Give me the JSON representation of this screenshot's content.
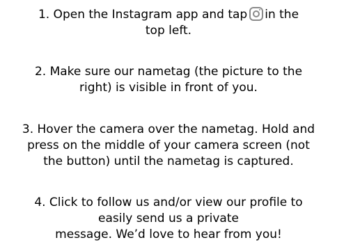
{
  "instructions": {
    "step1": {
      "line1_before_icon": "1.  Open the Instagram app and tap",
      "icon": "instagram-camera-icon",
      "line1_after_icon": "in the",
      "line2": "top left."
    },
    "step2": {
      "line1": "2. Make sure our nametag (the picture to the",
      "line2": "right) is visible in front of you."
    },
    "step3": {
      "line1": "3. Hover the camera over the nametag. Hold and",
      "line2": "press on the middle of your camera screen (not",
      "line3": "the button) until the nametag is captured."
    },
    "step4": {
      "line1": "4. Click to follow us and/or view our profile to",
      "line2": "easily send us a private",
      "line3": "message.  We’d love to hear from you!"
    }
  }
}
